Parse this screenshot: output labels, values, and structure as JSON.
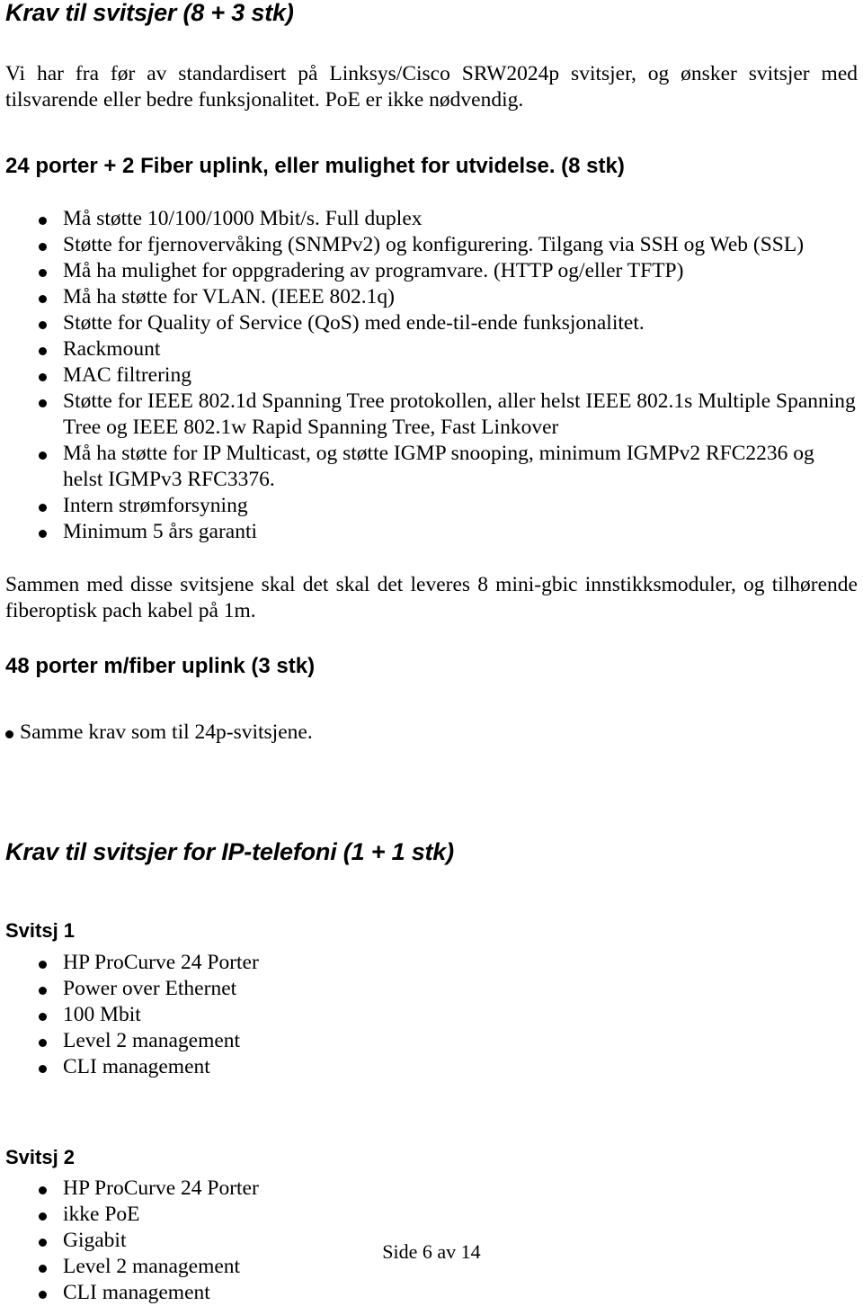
{
  "document": {
    "section_switches": {
      "heading": "Krav til svitsjer (8 + 3 stk)",
      "intro_paragraph": "Vi har fra før av standardisert på Linksys/Cisco SRW2024p svitsjer, og ønsker svitsjer med tilsvarende eller bedre funksjonalitet. PoE er ikke nødvendig.",
      "subheading_24port": "24 porter + 2 Fiber uplink, eller mulighet for utvidelse. (8 stk)",
      "requirements": [
        "Må støtte 10/100/1000 Mbit/s. Full duplex",
        "Støtte for fjernovervåking (SNMPv2) og konfigurering. Tilgang via SSH og Web (SSL)",
        "Må ha mulighet for oppgradering av programvare. (HTTP og/eller TFTP)",
        "Må ha støtte for VLAN. (IEEE 802.1q)",
        "Støtte for Quality of Service (QoS) med ende-til-ende funksjonalitet.",
        "Rackmount",
        "MAC filtrering",
        "Støtte for IEEE 802.1d Spanning Tree protokollen, aller helst IEEE 802.1s Multiple Spanning Tree og IEEE 802.1w Rapid Spanning Tree, Fast Linkover",
        "Må ha støtte for IP Multicast, og støtte IGMP snooping, minimum IGMPv2 RFC2236 og helst IGMPv3 RFC3376.",
        "Intern strømforsyning",
        "Minimum 5 års garanti"
      ],
      "closing_paragraph": "Sammen med disse svitsjene skal det skal det leveres 8 mini-gbic innstikksmoduler, og tilhørende fiberoptisk pach kabel på 1m.",
      "subheading_48port": "48 porter m/fiber uplink (3 stk)",
      "port48_requirements": [
        "Samme krav som til 24p-svitsjene."
      ]
    },
    "section_iptelefoni": {
      "heading": "Krav til svitsjer for  IP-telefoni  (1 + 1 stk)",
      "switch1": {
        "title": "Svitsj 1",
        "items": [
          "HP ProCurve 24 Porter",
          "Power over Ethernet",
          "100 Mbit",
          "Level 2 management",
          "CLI management"
        ]
      },
      "switch2": {
        "title": "Svitsj 2",
        "items": [
          "HP ProCurve 24 Porter",
          "ikke PoE",
          "Gigabit",
          "Level 2 management",
          "CLI management"
        ]
      }
    },
    "footer": {
      "page_label": "Side 6 av 14"
    }
  }
}
